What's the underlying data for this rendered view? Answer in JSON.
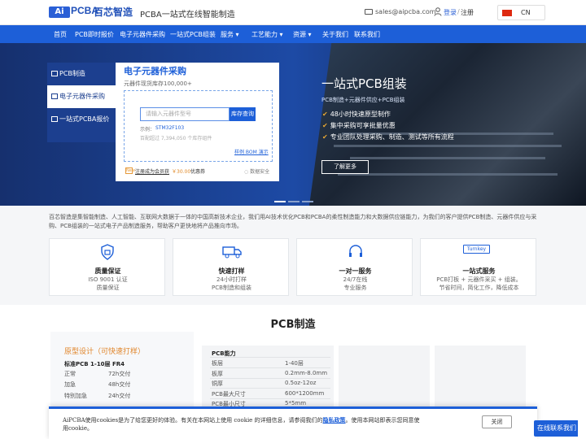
{
  "header": {
    "logo_mark": "Ai",
    "logo_text": "PCBA",
    "logo_cn": "百芯智造",
    "tagline": "PCBA一站式在线智能制造",
    "email": "sales@aipcba.com",
    "login": "登录",
    "separator": "/",
    "register": "注册",
    "language": "CN"
  },
  "nav": {
    "items": [
      "首页",
      "PCB即时报价",
      "电子元器件采购",
      "一站式PCB组装",
      "服务",
      "工艺能力",
      "资源",
      "关于我们",
      "联系我们"
    ]
  },
  "hero": {
    "left_menu": [
      "PCB制造",
      "电子元器件采购",
      "一站式PCBA报价"
    ],
    "panel": {
      "title": "电子元器件采购",
      "subtitle": "元器件现货库存100,000+",
      "search_placeholder": "请输入元器件型号",
      "search_button": "库存查询",
      "example_label": "示例：",
      "example_code": "STM32F103",
      "progress_text": "百配超过 7,394,050 个库存组件",
      "bom_link": "样例 BOM 演示",
      "footer_icon": "New",
      "footer_text": "注册成为会员获",
      "footer_amount": "￥30.00",
      "footer_tail": "优惠券",
      "secure_text": "数据安全"
    },
    "title": "一站式PCB组装",
    "subtitle": "PCB制造+元器件供应+PCB组装",
    "bullets": [
      "48小时快速原型制作",
      "集中采购可享批量优惠",
      "专业团队处理采购、制造、测试等所有流程"
    ],
    "button": "了解更多"
  },
  "intro": "百芯智造是集智能制造、人工智能、互联网大数据于一体的中国高新技术企业，我们用AI技术优化PCB和PCBA的柔性制造能力和大数据供应链能力，为我们的客户提供PCB制造、元器件供应与采购、PCB组装的一站式电子产品制造服务，帮助客户更快地将产品推向市场。",
  "features": [
    {
      "icon": "shield-lock-icon",
      "title": "质量保证",
      "lines": [
        "ISO 9001 认证",
        "质量保证"
      ]
    },
    {
      "icon": "truck-icon",
      "title": "快速打样",
      "lines": [
        "24小时打样",
        "PCB制造和组装"
      ]
    },
    {
      "icon": "headset-icon",
      "title": "一对一服务",
      "lines": [
        "24/7在线",
        "专业服务"
      ]
    },
    {
      "icon": "turnkey-icon",
      "badge": "Turnkey",
      "title": "一站式服务",
      "lines": [
        "PCB打板 + 元器件采买 + 组装。",
        "节省时间，简化工作，降低成本"
      ]
    }
  ],
  "pcb_section": {
    "title": "PCB制造",
    "card_title": "原型设计（可快速打样）",
    "standard": "标准PCB 1-10层 FR4",
    "rows": [
      {
        "k": "正常",
        "v": "72h交付"
      },
      {
        "k": "加急",
        "v": "48h交付"
      },
      {
        "k": "特别加急",
        "v": "24h交付"
      }
    ],
    "capability_title": "PCB能力",
    "capabilities": [
      {
        "k": "板层",
        "v": "1-40层"
      },
      {
        "k": "板厚",
        "v": "0.2mm-8.0mm"
      },
      {
        "k": "铜厚",
        "v": "0.5oz-12oz"
      },
      {
        "k": "PCB最大尺寸",
        "v": "600*1200mm"
      },
      {
        "k": "PCB最小尺寸",
        "v": "5*5mm"
      }
    ]
  },
  "cookie": {
    "text_a": "AiPCBA使用cookies是为了给您更好的体验。有关在本网站上使用 cookie 的详细信息，请参阅我们的",
    "link": "隐私政策",
    "text_b": "。使用本网站即表示您同意使用cookie。",
    "close": "关闭"
  },
  "contact": "在线联系我们",
  "colors": {
    "brand": "#1d5fd8",
    "accent": "#e0852a"
  }
}
